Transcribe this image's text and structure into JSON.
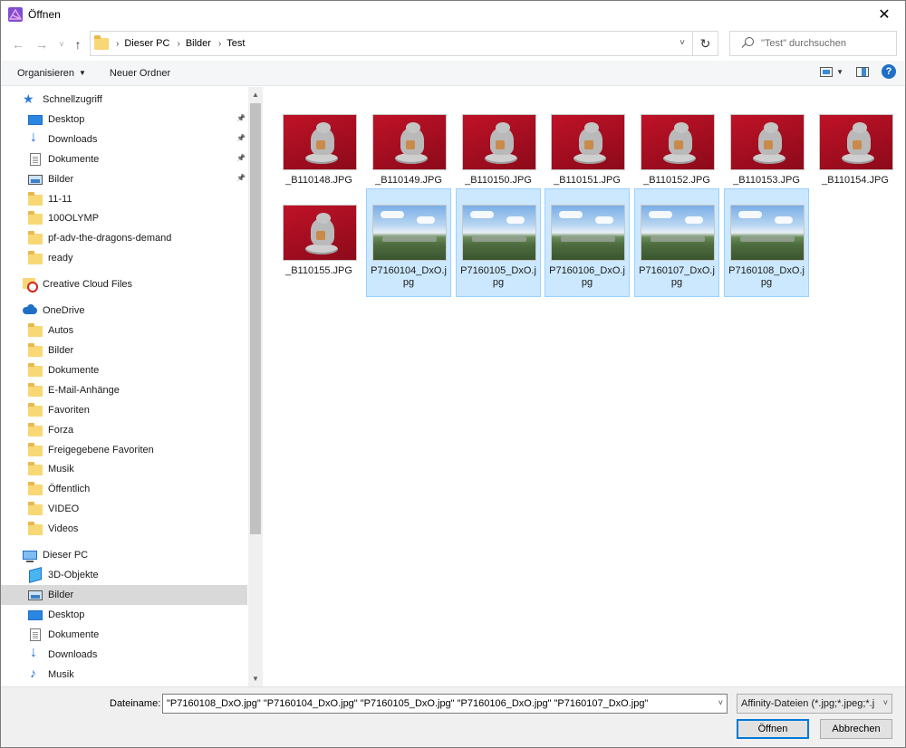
{
  "window": {
    "title": "Öffnen",
    "close": "✕"
  },
  "nav": {
    "back": "←",
    "forward": "→",
    "recent": "˅",
    "up": "↑",
    "breadcrumb": [
      "Dieser PC",
      "Bilder",
      "Test"
    ],
    "refresh": "↻",
    "search_placeholder": "\"Test\" durchsuchen"
  },
  "toolbar": {
    "organize": "Organisieren",
    "new_folder": "Neuer Ordner",
    "help": "?"
  },
  "sidebar": {
    "items": [
      {
        "label": "Schnellzugriff",
        "icon": "star-icon",
        "pinned": false,
        "level": 1
      },
      {
        "label": "Desktop",
        "icon": "desktop-icon",
        "pinned": true,
        "level": 2
      },
      {
        "label": "Downloads",
        "icon": "download-icon",
        "pinned": true,
        "level": 2
      },
      {
        "label": "Dokumente",
        "icon": "document-icon",
        "pinned": true,
        "level": 2
      },
      {
        "label": "Bilder",
        "icon": "pictures-icon",
        "pinned": true,
        "level": 2
      },
      {
        "label": "11-11",
        "icon": "folder-icon",
        "pinned": false,
        "level": 2
      },
      {
        "label": "100OLYMP",
        "icon": "folder-icon",
        "pinned": false,
        "level": 2
      },
      {
        "label": "pf-adv-the-dragons-demand",
        "icon": "folder-icon",
        "pinned": false,
        "level": 2
      },
      {
        "label": "ready",
        "icon": "folder-icon",
        "pinned": false,
        "level": 2
      },
      {
        "label": "Creative Cloud Files",
        "icon": "creative-cloud-icon",
        "pinned": false,
        "level": 1
      },
      {
        "label": "OneDrive",
        "icon": "cloud-icon",
        "pinned": false,
        "level": 1
      },
      {
        "label": "Autos",
        "icon": "folder-icon",
        "pinned": false,
        "level": 2
      },
      {
        "label": "Bilder",
        "icon": "folder-icon",
        "pinned": false,
        "level": 2
      },
      {
        "label": "Dokumente",
        "icon": "folder-icon",
        "pinned": false,
        "level": 2
      },
      {
        "label": "E-Mail-Anhänge",
        "icon": "folder-icon",
        "pinned": false,
        "level": 2
      },
      {
        "label": "Favoriten",
        "icon": "folder-icon",
        "pinned": false,
        "level": 2
      },
      {
        "label": "Forza",
        "icon": "folder-icon",
        "pinned": false,
        "level": 2
      },
      {
        "label": "Freigegebene Favoriten",
        "icon": "folder-icon",
        "pinned": false,
        "level": 2
      },
      {
        "label": "Musik",
        "icon": "folder-icon",
        "pinned": false,
        "level": 2
      },
      {
        "label": "Öffentlich",
        "icon": "folder-icon",
        "pinned": false,
        "level": 2
      },
      {
        "label": "VIDEO",
        "icon": "folder-icon",
        "pinned": false,
        "level": 2
      },
      {
        "label": "Videos",
        "icon": "folder-icon",
        "pinned": false,
        "level": 2
      },
      {
        "label": "Dieser PC",
        "icon": "computer-icon",
        "pinned": false,
        "level": 1
      },
      {
        "label": "3D-Objekte",
        "icon": "3d-objects-icon",
        "pinned": false,
        "level": 2
      },
      {
        "label": "Bilder",
        "icon": "pictures-icon",
        "pinned": false,
        "level": 2,
        "selected": true
      },
      {
        "label": "Desktop",
        "icon": "desktop-icon",
        "pinned": false,
        "level": 2
      },
      {
        "label": "Dokumente",
        "icon": "document-icon",
        "pinned": false,
        "level": 2
      },
      {
        "label": "Downloads",
        "icon": "download-icon",
        "pinned": false,
        "level": 2
      },
      {
        "label": "Musik",
        "icon": "music-icon",
        "pinned": false,
        "level": 2
      }
    ]
  },
  "files": [
    {
      "name": "_B110148.JPG",
      "thumb": "red",
      "selected": false
    },
    {
      "name": "_B110149.JPG",
      "thumb": "red",
      "selected": false
    },
    {
      "name": "_B110150.JPG",
      "thumb": "red",
      "selected": false
    },
    {
      "name": "_B110151.JPG",
      "thumb": "red",
      "selected": false
    },
    {
      "name": "_B110152.JPG",
      "thumb": "red",
      "selected": false
    },
    {
      "name": "_B110153.JPG",
      "thumb": "red",
      "selected": false
    },
    {
      "name": "_B110154.JPG",
      "thumb": "red",
      "selected": false
    },
    {
      "name": "_B110155.JPG",
      "thumb": "red",
      "selected": false
    },
    {
      "name": "P7160104_DxO.jpg",
      "thumb": "landscape",
      "selected": true
    },
    {
      "name": "P7160105_DxO.jpg",
      "thumb": "landscape",
      "selected": true
    },
    {
      "name": "P7160106_DxO.jpg",
      "thumb": "landscape",
      "selected": true
    },
    {
      "name": "P7160107_DxO.jpg",
      "thumb": "landscape",
      "selected": true
    },
    {
      "name": "P7160108_DxO.jpg",
      "thumb": "landscape",
      "selected": true
    }
  ],
  "footer": {
    "filename_label": "Dateiname:",
    "filename_value": "\"P7160108_DxO.jpg\" \"P7160104_DxO.jpg\" \"P7160105_DxO.jpg\" \"P7160106_DxO.jpg\" \"P7160107_DxO.jpg\"",
    "filetype": "Affinity-Dateien (*.jpg;*.jpeg;*.j",
    "open": "Öffnen",
    "cancel": "Abbrechen"
  },
  "colors": {
    "selection_bg": "#cce8ff",
    "selection_border": "#99d1ff",
    "accent": "#0078d7"
  }
}
